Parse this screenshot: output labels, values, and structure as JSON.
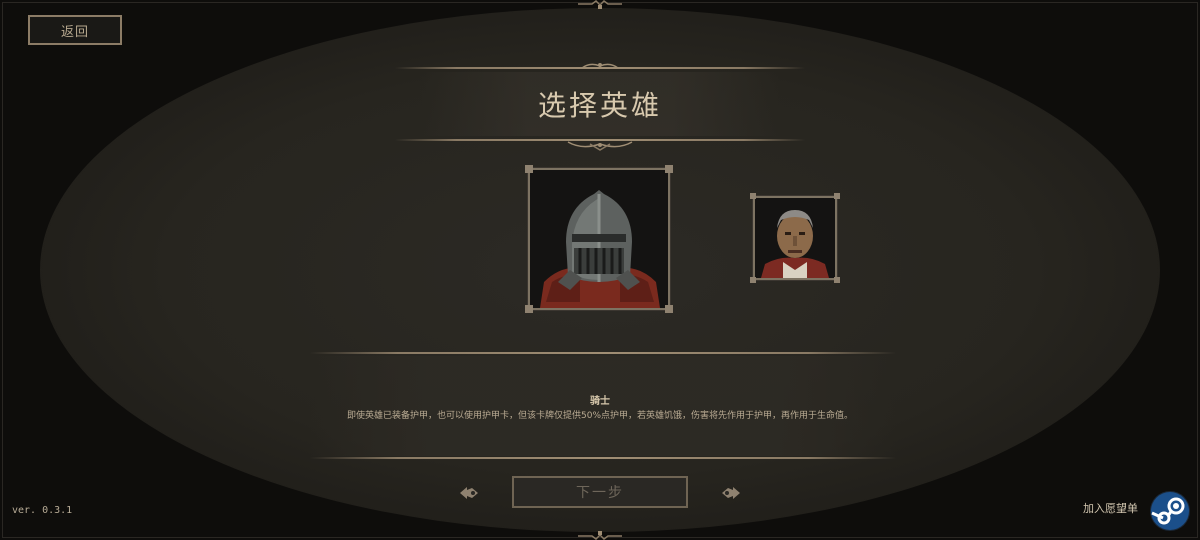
{
  "nav": {
    "back_label": "返回"
  },
  "title": "选择英雄",
  "heroes": [
    {
      "name": "骑士",
      "icon": "knight-helmet-portrait",
      "selected": true
    },
    {
      "name": "",
      "icon": "grey-haired-man-portrait",
      "selected": false
    }
  ],
  "selected_hero": {
    "name": "骑士",
    "description": "即使英雄已装备护甲，也可以使用护甲卡，但该卡牌仅提供50%点护甲，若英雄饥饿，伤害将先作用于护甲，再作用于生命值。"
  },
  "footer": {
    "next_label": "下一步",
    "version": "ver. 0.3.1",
    "wishlist_label": "加入愿望单"
  },
  "colors": {
    "background": "#0e0d0b",
    "panel": "#2a2824",
    "border": "#8c7c66",
    "title_text": "#d8c9ae",
    "steam": "#1b2838"
  }
}
